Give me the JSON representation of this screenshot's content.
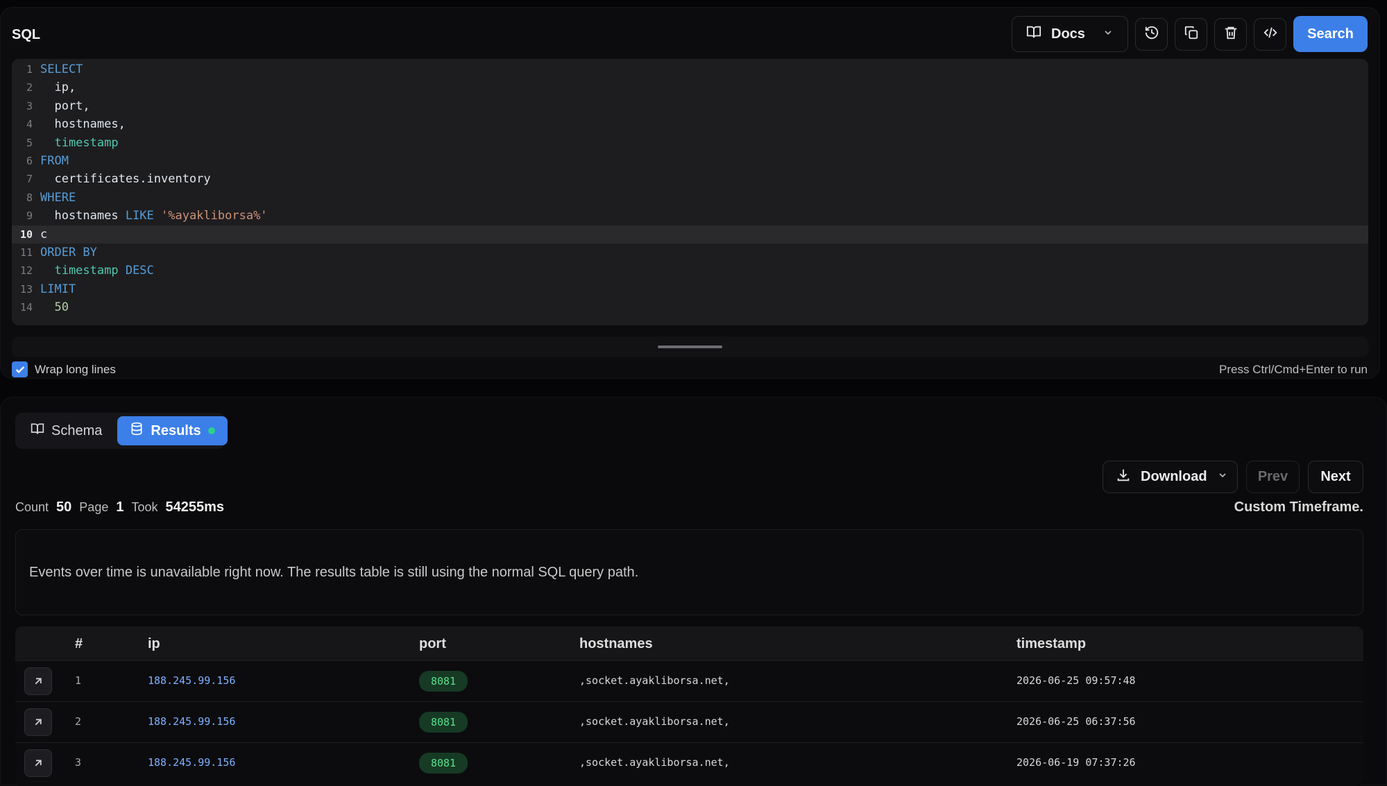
{
  "sql_panel": {
    "title": "SQL",
    "docs_label": "Docs",
    "search_label": "Search",
    "wrap_label": "Wrap long lines",
    "run_hint": "Press Ctrl/Cmd+Enter to run",
    "lines": [
      {
        "n": "1",
        "tokens": [
          {
            "t": "kw",
            "v": "SELECT"
          }
        ]
      },
      {
        "n": "2",
        "tokens": [
          {
            "t": "id",
            "v": "  ip,"
          }
        ]
      },
      {
        "n": "3",
        "tokens": [
          {
            "t": "id",
            "v": "  port,"
          }
        ]
      },
      {
        "n": "4",
        "tokens": [
          {
            "t": "id",
            "v": "  hostnames,"
          }
        ]
      },
      {
        "n": "5",
        "tokens": [
          {
            "t": "fn",
            "v": "  timestamp"
          }
        ]
      },
      {
        "n": "6",
        "tokens": [
          {
            "t": "kw",
            "v": "FROM"
          }
        ]
      },
      {
        "n": "7",
        "tokens": [
          {
            "t": "id",
            "v": "  certificates.inventory"
          }
        ]
      },
      {
        "n": "8",
        "tokens": [
          {
            "t": "kw",
            "v": "WHERE"
          }
        ]
      },
      {
        "n": "9",
        "tokens": [
          {
            "t": "id",
            "v": "  hostnames "
          },
          {
            "t": "kw",
            "v": "LIKE "
          },
          {
            "t": "str",
            "v": "'%ayakliborsa%'"
          }
        ]
      },
      {
        "n": "10",
        "active": true,
        "tokens": [
          {
            "t": "id",
            "v": "c"
          }
        ]
      },
      {
        "n": "11",
        "tokens": [
          {
            "t": "kw",
            "v": "ORDER BY"
          }
        ]
      },
      {
        "n": "12",
        "tokens": [
          {
            "t": "fn",
            "v": "  timestamp "
          },
          {
            "t": "kw",
            "v": "DESC"
          }
        ]
      },
      {
        "n": "13",
        "tokens": [
          {
            "t": "kw",
            "v": "LIMIT"
          }
        ]
      },
      {
        "n": "14",
        "tokens": [
          {
            "t": "num",
            "v": "  50"
          }
        ]
      }
    ]
  },
  "results_panel": {
    "tabs": {
      "schema": "Schema",
      "results": "Results"
    },
    "download_label": "Download",
    "prev_label": "Prev",
    "next_label": "Next",
    "stats": {
      "count_label": "Count",
      "count": "50",
      "page_label": "Page",
      "page": "1",
      "took_label": "Took",
      "took": "54255ms"
    },
    "timeframe": "Custom Timeframe.",
    "notice": "Events over time is unavailable right now. The results table is still using the normal SQL query path.",
    "table": {
      "headers": [
        "#",
        "ip",
        "port",
        "hostnames",
        "timestamp"
      ],
      "rows": [
        {
          "idx": "1",
          "ip": "188.245.99.156",
          "port": "8081",
          "hostnames": ",socket.ayakliborsa.net,",
          "timestamp": "2026-06-25 09:57:48"
        },
        {
          "idx": "2",
          "ip": "188.245.99.156",
          "port": "8081",
          "hostnames": ",socket.ayakliborsa.net,",
          "timestamp": "2026-06-25 06:37:56"
        },
        {
          "idx": "3",
          "ip": "188.245.99.156",
          "port": "8081",
          "hostnames": ",socket.ayakliborsa.net,",
          "timestamp": "2026-06-19 07:37:26"
        }
      ]
    }
  },
  "colors": {
    "accent": "#3d7fe8",
    "port_badge": "#57e08d",
    "status_dot": "#2bd18b"
  }
}
